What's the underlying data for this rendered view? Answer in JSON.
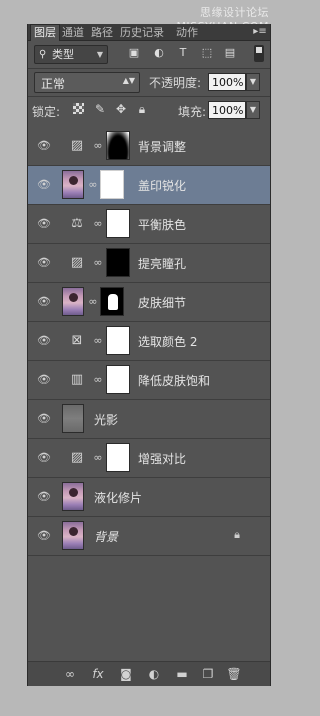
{
  "watermark": "思缘设计论坛 www.MISSYUAN.COM",
  "tabs": [
    "图层",
    "通道",
    "路径",
    "历史记录",
    "动作"
  ],
  "tab_menu_icon": "panel-menu-icon",
  "filter": {
    "kind_label": "类型"
  },
  "blend": {
    "mode": "正常",
    "opacity_label": "不透明度:",
    "opacity_value": "100%"
  },
  "lock": {
    "label": "锁定:",
    "fill_label": "填充:",
    "fill_value": "100%"
  },
  "layers": [
    {
      "name": "背景调整",
      "type": "adjustment",
      "icon": "curves-icon",
      "mask": "bgmask",
      "selected": false
    },
    {
      "name": "盖印锐化",
      "type": "pixel-masked",
      "mask": "white",
      "selected": true
    },
    {
      "name": "平衡肤色",
      "type": "adjustment",
      "icon": "color-balance-icon",
      "mask": "white",
      "selected": false
    },
    {
      "name": "提亮瞳孔",
      "type": "adjustment",
      "icon": "curves-icon",
      "mask": "black",
      "selected": false
    },
    {
      "name": "皮肤细节",
      "type": "pixel-masked",
      "mask": "skinmask",
      "selected": false
    },
    {
      "name": "选取颜色 2",
      "type": "adjustment",
      "icon": "selective-color-icon",
      "mask": "white",
      "selected": false
    },
    {
      "name": "降低皮肤饱和",
      "type": "adjustment",
      "icon": "hue-saturation-icon",
      "mask": "white",
      "selected": false
    },
    {
      "name": "光影",
      "type": "pixel-gray",
      "selected": false
    },
    {
      "name": "增强对比",
      "type": "adjustment",
      "icon": "curves-icon",
      "mask": "white",
      "selected": false
    },
    {
      "name": "液化修片",
      "type": "pixel",
      "selected": false
    },
    {
      "name": "背景",
      "type": "background",
      "locked": true,
      "selected": false
    }
  ],
  "footer_icons": [
    "link-icon",
    "fx-icon",
    "add-mask-icon",
    "adjustment-layer-icon",
    "group-folder-icon",
    "new-layer-icon",
    "trash-icon"
  ],
  "colors": {
    "panel": "#535353",
    "selected_row": "#6d7d94",
    "tabbar": "#3b3b3b"
  }
}
